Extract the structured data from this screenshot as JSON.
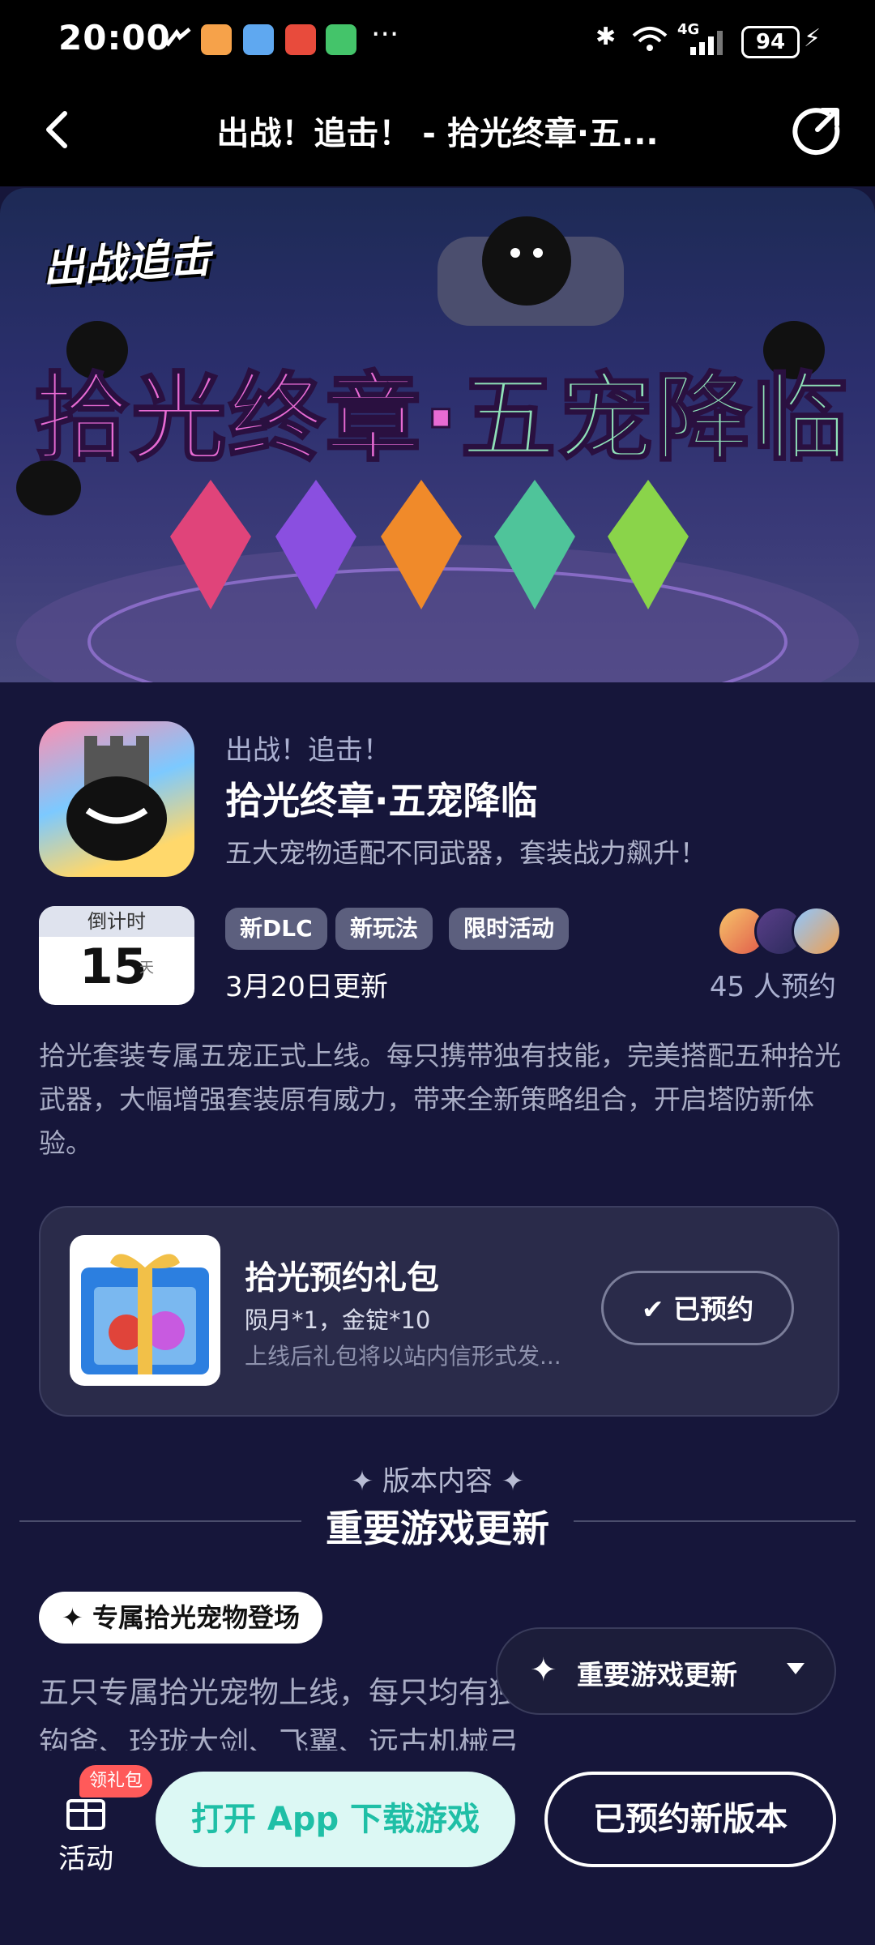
{
  "status_bar": {
    "time": "20:00",
    "more": "···",
    "network": "4G",
    "battery": "94"
  },
  "header": {
    "title": "出战！追击！ - 拾光终章·五..."
  },
  "banner": {
    "logo_text": "出战追击",
    "title_part1": "拾光终章·",
    "title_part2": "五宠降临"
  },
  "info": {
    "game_name": "出战！追击！",
    "dlc_title": "拾光终章·五宠降临",
    "subtitle": "五大宠物适配不同武器，套装战力飙升！",
    "countdown_label": "倒计时",
    "countdown_value": "15",
    "countdown_unit": "天",
    "tags": [
      "新DLC",
      "新玩法",
      "限时活动"
    ],
    "update_date": "3月20日更新",
    "reserve_count": "45 人预约",
    "description": "拾光套装专属五宠正式上线。每只携带独有技能，完美搭配五种拾光武器，大幅增强套装原有威力，带来全新策略组合，开启塔防新体验。"
  },
  "gift": {
    "title": "拾光预约礼包",
    "items": "陨月*1，金锭*10",
    "note": "上线后礼包将以站内信形式发...",
    "button": "已预约"
  },
  "section": {
    "subtitle": "✦ 版本内容 ✦",
    "title": "重要游戏更新",
    "pill": "专属拾光宠物登场",
    "body": "五只专属拾光宠物上线，每只均有独特技能，分别适配上古钩爸、玲珑大剑、飞翼、远古机械弓",
    "dropdown_label": "重要游戏更新"
  },
  "bottom_bar": {
    "activity_label": "活动",
    "activity_badge": "领礼包",
    "open_app": "打开 App 下载游戏",
    "reserved_new": "已预约新版本"
  },
  "colors": {
    "background": "#16163a",
    "accent_teal": "#1fbfa6",
    "badge_red": "#ff5a5a"
  }
}
